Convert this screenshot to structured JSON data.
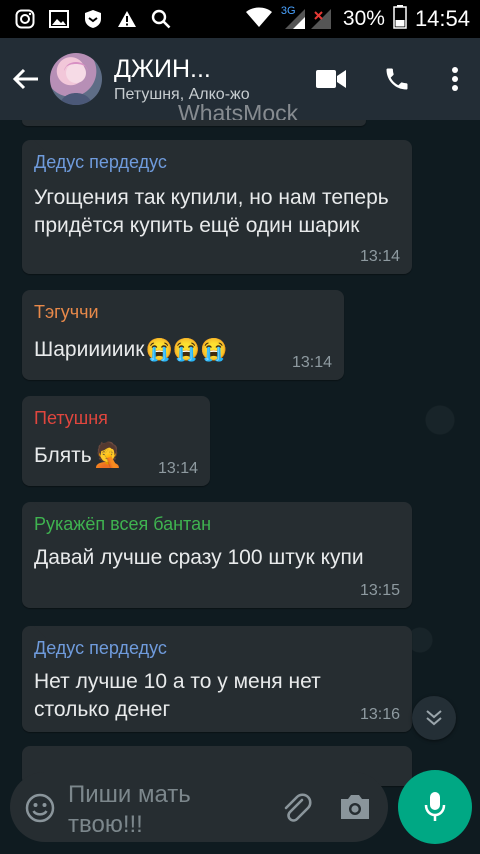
{
  "status_bar": {
    "battery": "30%",
    "time": "14:54",
    "network_label": "3G",
    "icons": [
      "instagram-icon",
      "gallery-icon",
      "shield-icon",
      "warning-icon",
      "search-icon",
      "wifi-icon",
      "signal-icon",
      "battery-icon"
    ]
  },
  "header": {
    "title": "ДЖИН...",
    "subtitle": "Петушня, Алко-жо",
    "watermark": "WhatsMock"
  },
  "messages": [
    {
      "sender": "Дедус пердедус",
      "sender_color": "#6f9bdc",
      "text": "Угощения так купили, но нам теперь придётся купить ещё один шарик",
      "time": "13:14"
    },
    {
      "sender": "Тэгуччи",
      "sender_color": "#e8894a",
      "text": "Шарииииик",
      "emoji": "😭😭😭",
      "time": "13:14"
    },
    {
      "sender": "Петушня",
      "sender_color": "#e0463e",
      "text": "Блять",
      "emoji": "🤦",
      "time": "13:14"
    },
    {
      "sender": "Рукажёп всея бантан",
      "sender_color": "#3fb350",
      "text": "Давай лучше сразу 100 штук купи",
      "time": "13:15"
    },
    {
      "sender": "Дедус пердедус",
      "sender_color": "#6f9bdc",
      "text": "Нет лучше 10 а то у меня нет столько денег",
      "time": "13:16"
    }
  ],
  "input": {
    "placeholder": "Пиши мать твою!!!"
  },
  "colors": {
    "accent": "#00a884",
    "header_bg": "#232d36",
    "bubble_bg": "#262d31"
  }
}
